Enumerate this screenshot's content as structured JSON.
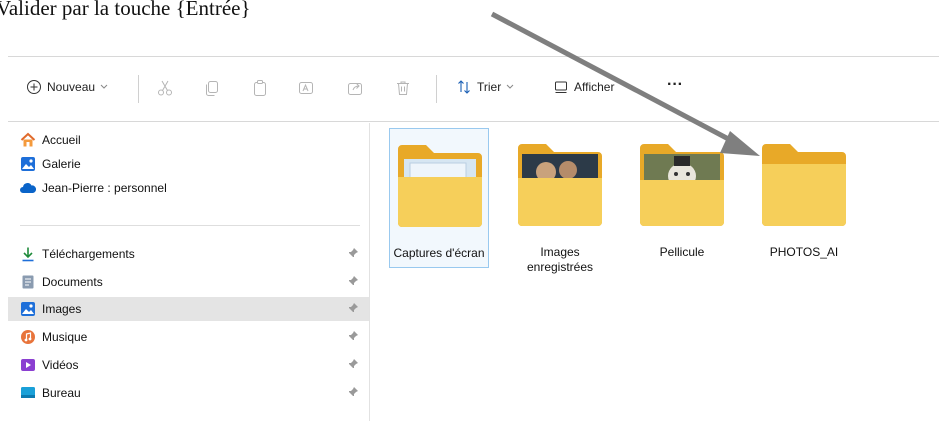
{
  "caption": "Valider par la touche {Entrée}",
  "toolbar": {
    "new_label": "Nouveau",
    "sort_label": "Trier",
    "view_label": "Afficher",
    "more_label": "···"
  },
  "nav": {
    "quick": [
      {
        "label": "Accueil",
        "icon": "home-icon"
      },
      {
        "label": "Galerie",
        "icon": "gallery-icon"
      },
      {
        "label": "Jean-Pierre : personnel",
        "icon": "onedrive-cloud-icon"
      }
    ],
    "pinned": [
      {
        "label": "Téléchargements",
        "icon": "download-icon"
      },
      {
        "label": "Documents",
        "icon": "documents-icon"
      },
      {
        "label": "Images",
        "icon": "images-icon",
        "selected": true
      },
      {
        "label": "Musique",
        "icon": "music-icon"
      },
      {
        "label": "Vidéos",
        "icon": "videos-icon"
      },
      {
        "label": "Bureau",
        "icon": "desktop-icon"
      }
    ]
  },
  "folders": [
    {
      "label": "Captures d'écran",
      "selected": true
    },
    {
      "label": "Images enregistrées"
    },
    {
      "label": "Pellicule"
    },
    {
      "label": "PHOTOS_AI"
    }
  ],
  "colors": {
    "folder": "#f3c94d",
    "folder_back": "#e8a928",
    "selection": "#e4e4e4",
    "arrow": "#7f7f7f",
    "accent": "#0067c0"
  }
}
